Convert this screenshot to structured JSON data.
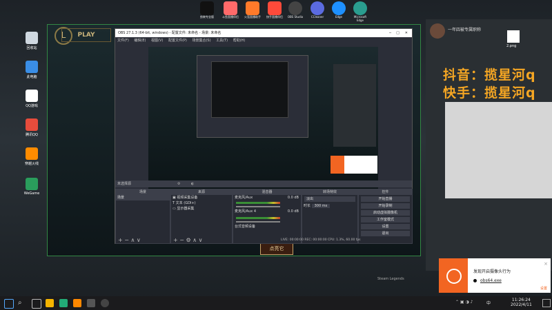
{
  "desktop_icons": [
    {
      "label": "回收站",
      "color": "#cfd8e0"
    },
    {
      "label": "此电脑",
      "color": "#3a8ee6"
    },
    {
      "label": "QQ游戏",
      "color": "#ffffff"
    },
    {
      "label": "腾讯QQ",
      "color": "#e74c3c"
    },
    {
      "label": "穿越火线",
      "color": "#ff8c00"
    },
    {
      "label": "WeGame",
      "color": "#2a9d5c"
    }
  ],
  "top_icons": [
    {
      "label": "剪映专业版",
      "color": "#111111"
    },
    {
      "label": "斗鱼直播伴侣",
      "color": "#ff6a6a"
    },
    {
      "label": "火萤直播助手",
      "color": "#ff7a2a"
    },
    {
      "label": "快手直播伴侣",
      "color": "#ff4a3a"
    },
    {
      "label": "OBS Studio",
      "color": "#444444"
    },
    {
      "label": "CCleaner",
      "color": "#5b6be0"
    },
    {
      "label": "Edge",
      "color": "#1e90ff"
    },
    {
      "label": "Microsoft Edge",
      "color": "#2a9d8f"
    }
  ],
  "game": {
    "play_label": "PLAY",
    "confirm_label": "点亮它",
    "footer": "Steam Legends"
  },
  "obs": {
    "title": "OBS 27.1.3 (64-bit, windows) - 配置文件: 未命名 - 场景: 未命名",
    "menu": [
      "文件(F)",
      "编辑(E)",
      "视图(V)",
      "配置文件(P)",
      "场景集合(S)",
      "工具(T)",
      "帮助(H)"
    ],
    "scene_label": "未选择源",
    "panels": {
      "scenes": "场景",
      "sources": "来源",
      "mixer": "混音器",
      "transitions": "转场特效",
      "controls": "控件"
    },
    "scene_items": [
      "场景"
    ],
    "source_items": [
      "视频采集设备",
      "文本 (GDI+)",
      "显示器采集"
    ],
    "mixer": [
      {
        "name": "麦克风/Aux",
        "db": "0.0 dB"
      },
      {
        "name": "麦克风/Aux 4",
        "db": "0.0 dB"
      },
      {
        "name": "台式音频设备"
      }
    ],
    "transition": {
      "type": "淡出",
      "duration_label": "时长",
      "duration": "300 ms"
    },
    "controls": [
      "开始直播",
      "开始录制",
      "启动虚拟摄像机",
      "工作室模式",
      "设置",
      "退出"
    ],
    "status": "LIVE: 00:00:00   REC: 00:00:00   CPU: 1.3%, 60.00 fps"
  },
  "chat": {
    "header": "一年四被专属职称",
    "overlay1": "抖音：揽星河q",
    "overlay2": "快手：揽星河q",
    "file": "2.png"
  },
  "notification": {
    "title": "发现开启摄像头行为",
    "app": "obs64.exe",
    "action": "设置"
  },
  "taskbar": {
    "time": "11:26:24",
    "date": "2022/4/11",
    "lang": "中"
  }
}
